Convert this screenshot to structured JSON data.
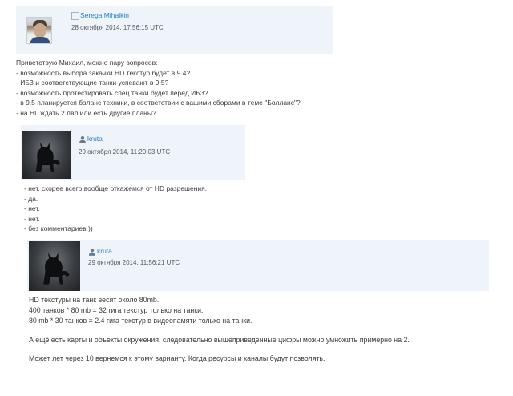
{
  "posts": [
    {
      "author": "Serega Mihalkin",
      "timestamp": "28 октября 2014, 17:56:15 UTC",
      "lines": [
        "Приветствую Михаил, можно пару вопросов:",
        "- возможность выбора закачки HD текстур будет в 9.4?",
        "- ИБЗ и соответствующие танки успевают в 9.5?",
        "- возможность протестировать спец танки будет перед ИБЗ?",
        "- в 9.5 планируется баланс техники, в соответствии с вашими сборами в теме \"Болланс\"?",
        "- на НГ ждать 2 лвл или есть другие планы?"
      ]
    },
    {
      "author": "kruta",
      "timestamp": "29 октября 2014, 11:20:03 UTC",
      "lines": [
        "- нет. скорее всего вообще откажемся от HD разрешения.",
        "- да.",
        "- нет.",
        "- нет.",
        "- без комментариев ))"
      ]
    },
    {
      "author": "kruta",
      "timestamp": "29 октября 2014, 11:56:21 UTC",
      "lines": [
        "HD текстуры на танк весят около 80mb.",
        "400 танков * 80 mb = 32 гига текстур только на танки.",
        "80 mb * 30 танков = 2.4 гига текстур в видеопамяти только на танки."
      ],
      "para2": "А ещё есть карты и объекты окружения, следовательно вышеприведенные цифры можно умножить примерно на 2.",
      "para3": "Может лет через 10 вернемся к этому варианту. Когда ресурсы и каналы будут позволять."
    }
  ],
  "icons": {
    "user_icon": "user-icon",
    "avatar_photo": "avatar",
    "avatar_cat": "black-cat-avatar"
  },
  "colors": {
    "header_bg": "#eef4f9",
    "username": "#2a7fc0",
    "text": "#3c3c3c"
  }
}
